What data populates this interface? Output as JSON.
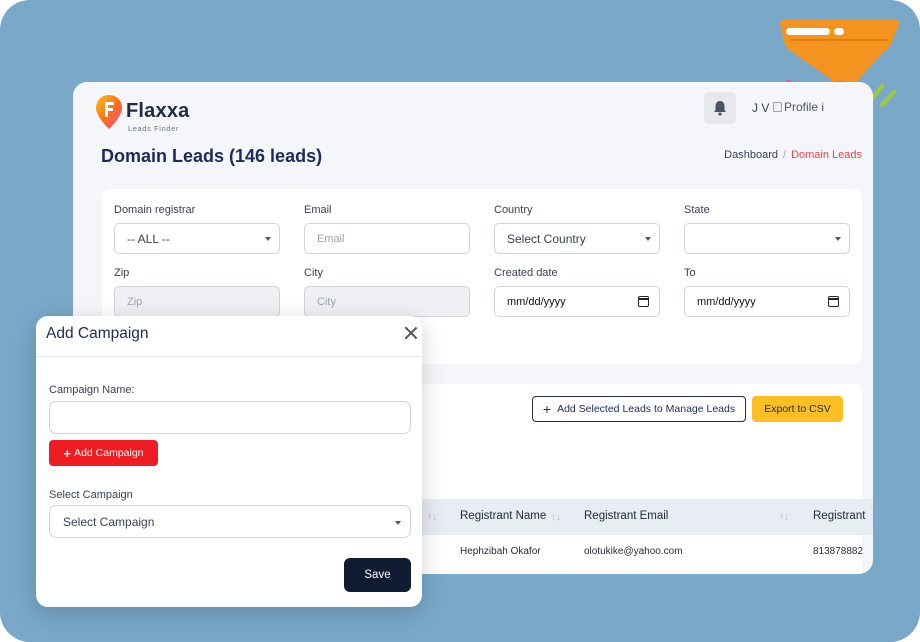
{
  "app": {
    "brand": "Flaxxa",
    "brand_sub": "Leads Finder",
    "user_initials": "J V",
    "profile_alt": "Profile i"
  },
  "page": {
    "title": "Domain Leads (146 leads)",
    "breadcrumb": [
      "Dashboard",
      "Domain Leads"
    ]
  },
  "filters": {
    "domain_registrar": {
      "label": "Domain registrar",
      "value": "-- ALL --"
    },
    "email": {
      "label": "Email",
      "placeholder": "Email"
    },
    "country": {
      "label": "Country",
      "value": "Select Country"
    },
    "state": {
      "label": "State",
      "value": ""
    },
    "zip": {
      "label": "Zip",
      "placeholder": "Zip"
    },
    "city": {
      "label": "City",
      "placeholder": "City"
    },
    "created_date": {
      "label": "Created date",
      "value": "mm/dd/yyyy"
    },
    "to": {
      "label": "To",
      "value": "mm/dd/yyyy"
    }
  },
  "actions": {
    "add_selected": "Add Selected Leads to Manage Leads",
    "export": "Export to CSV"
  },
  "table": {
    "columns": [
      "Registrant Name",
      "Registrant Email",
      "Registrant"
    ],
    "rows": [
      [
        "Hephzibah Okafor",
        "olotukike@yahoo.com",
        "813878882"
      ]
    ]
  },
  "modal": {
    "title": "Add Campaign",
    "campaign_name_label": "Campaign Name:",
    "campaign_name_value": "",
    "add_button": "Add Campaign",
    "select_label": "Select Campaign",
    "select_value": "Select Campaign",
    "save_button": "Save"
  },
  "colors": {
    "background": "#79a8c8",
    "navy": "#1e2a5a",
    "accent_red": "#ef1c24",
    "accent_yellow": "#fbbf24",
    "funnel_orange": "#f5931f"
  }
}
